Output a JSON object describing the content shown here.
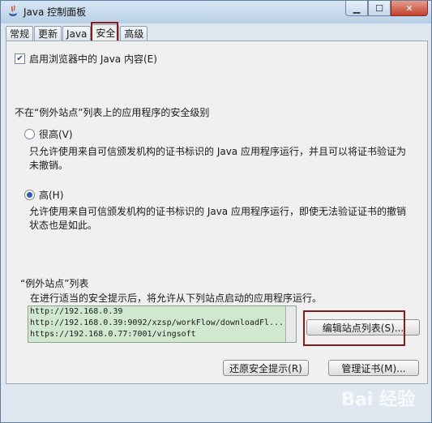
{
  "window": {
    "title": "Java 控制面板"
  },
  "tabs": [
    {
      "label": "常规"
    },
    {
      "label": "更新"
    },
    {
      "label": "Java"
    },
    {
      "label": "安全"
    },
    {
      "label": "高级"
    }
  ],
  "security": {
    "browser_checkbox_label": "启用浏览器中的 Java 内容(E)",
    "browser_checkbox_checked": true,
    "level_title": "不在“例外站点”列表上的应用程序的安全级别",
    "very_high": {
      "label": "很高(V)",
      "desc": "只允许使用来自可信颁发机构的证书标识的 Java 应用程序运行，并且可以将证书验证为未撤销。",
      "selected": false
    },
    "high": {
      "label": "高(H)",
      "desc": "允许使用来自可信颁发机构的证书标识的 Java 应用程序运行，即使无法验证证书的撤销状态也是如此。",
      "selected": true
    }
  },
  "exception_sites": {
    "title": "“例外站点”列表",
    "subtitle": "在进行适当的安全提示后，将允许从下列站点启动的应用程序运行。",
    "sites": [
      "http://192.168.0.39",
      "http://192.168.0.39:9092/xzsp/workFlow/downloadFl...",
      "https://192.168.0.77:7001/vingsoft"
    ],
    "edit_button": "编辑站点列表(S)..."
  },
  "bottom_buttons": {
    "restore_prompts": "还原安全提示(R)",
    "manage_certs": "管理证书(M)..."
  },
  "watermark": "Bai 经验"
}
